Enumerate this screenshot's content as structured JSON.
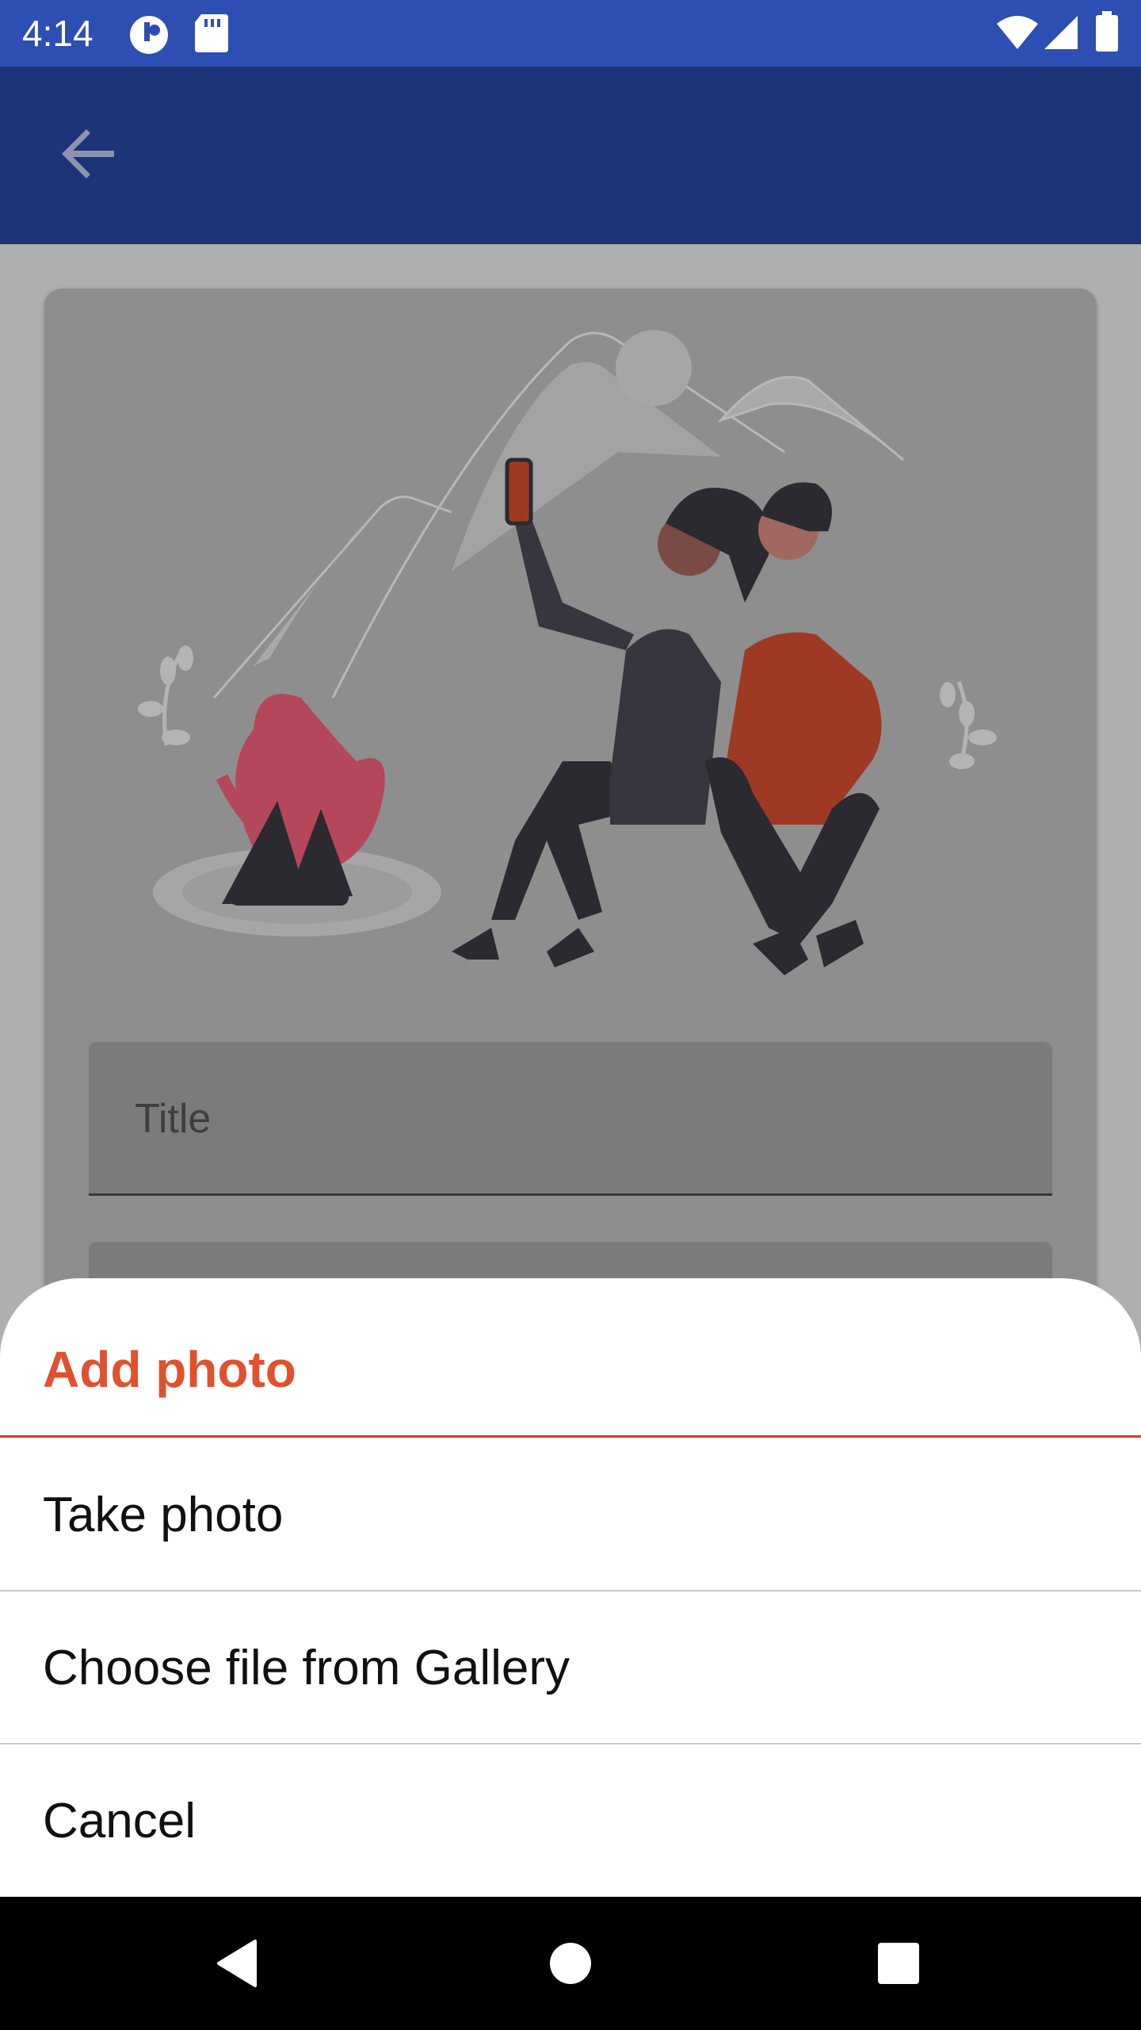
{
  "status_bar": {
    "time": "4:14",
    "icons": [
      "cloud-sync-icon",
      "sd-card-icon",
      "wifi-icon",
      "cellular-signal-icon",
      "battery-icon"
    ]
  },
  "app_bar": {
    "back_icon": "arrow-back-icon"
  },
  "form": {
    "title_placeholder": "Title"
  },
  "sheet": {
    "title": "Add photo",
    "options": [
      {
        "label": "Take photo"
      },
      {
        "label": "Choose file from Gallery"
      },
      {
        "label": "Cancel"
      }
    ]
  },
  "nav_bar": {
    "icons": [
      "nav-back-icon",
      "nav-home-icon",
      "nav-recents-icon"
    ]
  },
  "colors": {
    "status_bar": "#2d4eb2",
    "app_bar": "#1e3478",
    "accent": "#e0512f",
    "divider_accent": "#cf3e2d"
  }
}
